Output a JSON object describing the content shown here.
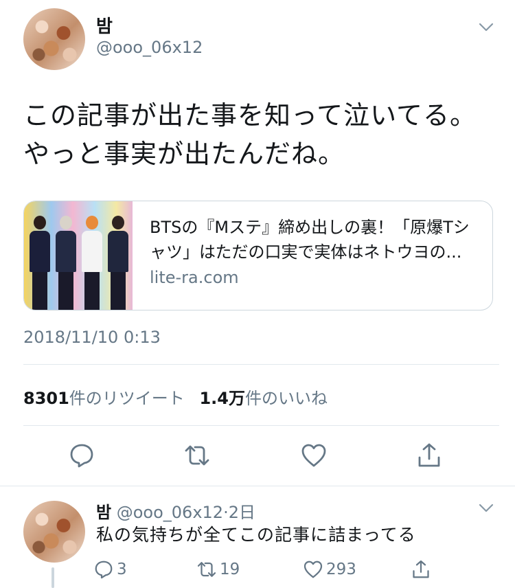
{
  "main_tweet": {
    "author_name": "밤",
    "handle": "@ooo_06x12",
    "text_line1": "この記事が出た事を知って泣いてる。",
    "text_line2": "やっと事実が出たんだね。",
    "link_card": {
      "title_line1": "BTSの『Mステ』締め出しの裏！「原爆Tシ",
      "title_line2": "ャツ」はただの口実で実体はネトウヨの...",
      "domain": "lite-ra.com"
    },
    "timestamp": "2018/11/10 0:13",
    "stats": {
      "retweet_count": "8301",
      "retweet_label": "件のリツイート",
      "like_count": "1.4万",
      "like_label": "件のいいね"
    },
    "actions": {
      "reply_icon": "reply-icon",
      "retweet_icon": "retweet-icon",
      "like_icon": "heart-icon",
      "share_icon": "share-icon"
    }
  },
  "reply_tweet": {
    "author_name": "밤",
    "handle": "@ooo_06x12",
    "separator": "·",
    "time": "2日",
    "text": "私の気持ちが全てこの記事に詰まってる",
    "reply_count": "3",
    "retweet_count": "19",
    "like_count": "293"
  },
  "colors": {
    "text_primary": "#14171a",
    "text_secondary": "#657786",
    "divider": "#e1e8ed",
    "card_border": "#ccd6dd"
  }
}
